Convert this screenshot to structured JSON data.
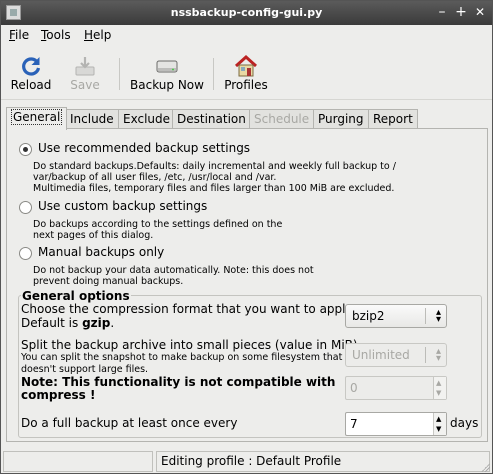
{
  "window": {
    "title": "nssbackup-config-gui.py"
  },
  "titlebar_buttons": {
    "minimize": "–",
    "maximize": "+",
    "close": "✕"
  },
  "menu": {
    "file": "File",
    "tools": "Tools",
    "help": "Help"
  },
  "toolbar": {
    "reload": "Reload",
    "save": "Save",
    "backup_now": "Backup Now",
    "profiles": "Profiles"
  },
  "tabs": [
    "General",
    "Include",
    "Exclude",
    "Destination",
    "Schedule",
    "Purging",
    "Report"
  ],
  "general": {
    "recommended": {
      "label": "Use recommended backup settings",
      "desc": [
        "Do standard backups.Defaults: daily incremental and weekly full backup to /",
        "var/backup of all user files, /etc, /usr/local and /var.",
        "Multimedia files, temporary files and files larger than 100 MiB are excluded."
      ]
    },
    "custom": {
      "label": "Use custom backup settings",
      "desc": [
        "Do backups according to the settings defined on the",
        "next pages of this dialog."
      ]
    },
    "manual": {
      "label": "Manual backups only",
      "desc": [
        "Do not backup your data automatically. Note: this does not",
        "prevent doing manual backups."
      ]
    },
    "selected": "recommended"
  },
  "options": {
    "title": "General options",
    "compression_label_1": "Choose the compression format that you want to apply.",
    "compression_label_2_prefix": "Default is ",
    "compression_label_2_bold": "gzip",
    "compression_label_2_suffix": ".",
    "compression_value": "bzip2",
    "split_label": "Split the backup archive into small pieces (value in MiB)",
    "split_small_1": "You can split the snapshot to make backup on some filesystem that",
    "split_small_2": "doesn't support large files.",
    "split_value": "Unlimited",
    "note_1": "Note: This functionality is not compatible with",
    "note_2": "compress !",
    "note_value": "0",
    "full_backup_label": "Do a full backup at least once every",
    "full_backup_value": "7",
    "full_backup_unit": "days"
  },
  "statusbar": {
    "text": "Editing profile : Default Profile"
  }
}
